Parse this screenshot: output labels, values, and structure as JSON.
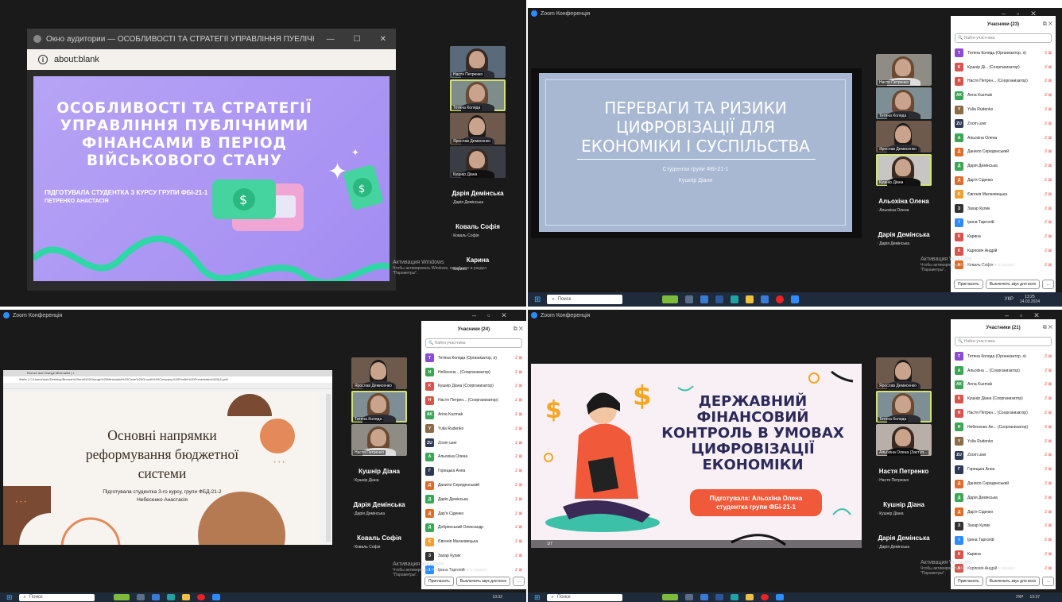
{
  "q1": {
    "browser_title": "Окно аудитории — ОСОБЛИВОСТІ ТА СТРАТЕГІЇ УПРАВЛІННЯ ПУЕЛІЧНИ...",
    "address": "about:blank",
    "slide_title_lines": [
      "ОСОБЛИВОСТІ ТА СТРАТЕГІЇ",
      "УПРАВЛІННЯ ПУБЛІЧНИМИ",
      "ФІНАНСАМИ В ПЕРІОД",
      "ВІЙСЬКОВОГО СТАНУ"
    ],
    "slide_sub1": "ПІДГОТУВАЛА СТУДЕНТКА 3 КУРСУ ГРУПИ ФБІ-21-1",
    "slide_sub2": "ПЕТРЕНКО АНАСТАСІЯ",
    "thumbs": [
      "Настя Петренко",
      "Тетяна Коляда",
      "Ярослав Демисенко",
      "Кушнір Діана"
    ],
    "name_tiles": [
      {
        "name": "Дарія Демінська",
        "sub": "Дарія Демінська"
      },
      {
        "name": "Коваль Софія",
        "sub": "Коваль Софія"
      },
      {
        "name": "Карина",
        "sub": "Карина"
      }
    ]
  },
  "q2": {
    "window_title": "Zoom Конференція",
    "slide_title_lines": [
      "ПЕРЕВАГИ ТА РИЗИКИ",
      "ЦИФРОВІЗАЦІЇ ДЛЯ",
      "ЕКОНОМІКИ І СУСПІЛЬСТВА"
    ],
    "slide_sub1": "Студентки групи ФБі-21-1",
    "slide_sub2": "Кушнір Діани",
    "thumbs": [
      "Настя Петренко",
      "Тетяна Коляда",
      "Ярослав Демисенко",
      "Кушнір Діана"
    ],
    "name_tiles": [
      {
        "name": "Альохіна Олена",
        "sub": "Альохіна Олена"
      },
      {
        "name": "Дарія Демінська",
        "sub": "Дарія Демінська"
      }
    ],
    "panel_title": "Учасники (23)",
    "search_placeholder": "Найти участника",
    "participants": [
      {
        "i": "T",
        "c": "#8a4bd6",
        "n": "Тетяна Коляда (Организатор, я)"
      },
      {
        "i": "К",
        "c": "#d9534f",
        "n": "Кушнір Ді... (Соорганизатор)"
      },
      {
        "i": "Н",
        "c": "#d9534f",
        "n": "Настя Петрен... (Соорганизатор)"
      },
      {
        "i": "AK",
        "c": "#3aa757",
        "n": "Anna Kuzmak"
      },
      {
        "i": "Y",
        "c": "#8b6b4a",
        "n": "Yulia Rudenko"
      },
      {
        "i": "ZU",
        "c": "#2e3a55",
        "n": "Zoom user"
      },
      {
        "i": "А",
        "c": "#3aa757",
        "n": "Альохіна Олена"
      },
      {
        "i": "Д",
        "c": "#e06c2a",
        "n": "Данило Середенський"
      },
      {
        "i": "Д",
        "c": "#3aa757",
        "n": "Дарія Демінська"
      },
      {
        "i": "Д",
        "c": "#e06c2a",
        "n": "Дар'я Сіденко"
      },
      {
        "i": "Є",
        "c": "#f0a030",
        "n": "Євгенія Малновецька"
      },
      {
        "i": "З",
        "c": "#333333",
        "n": "Захар Кулик"
      },
      {
        "i": "І",
        "c": "#2d8cff",
        "n": "Ірина Тарголій"
      },
      {
        "i": "К",
        "c": "#d9534f",
        "n": "Карина"
      },
      {
        "i": "К",
        "c": "#d9534f",
        "n": "Карповіч Андрій"
      },
      {
        "i": "К",
        "c": "#e06c2a",
        "n": "Коваль Софія"
      }
    ],
    "invite": "Пригласить",
    "mute_all": "Выключить звук для всех",
    "task_search": "Поиск",
    "time": "13:25",
    "date": "14.03.2024",
    "lang": "УКР"
  },
  "q3": {
    "window_title": "Zoom Конференція",
    "slide_title_lines": [
      "Основні напрямки",
      "реформування бюджетної",
      "системи"
    ],
    "slide_sub1": "Підготувала студентка 3-го курсу, групи ФБД-21-2",
    "slide_sub2": "Небесенко Анастасія",
    "tab_title": "Bronze and Orange Minimalist | ×",
    "url": "Файл | C:/Users/user/Desktop/Bronze%20and%20Orange%20Minimalist%20Circle%20Growth%20Company%20Profile%20Presentation%20(1).pdf",
    "thumbs": [
      "Ярослав Демисенко",
      "Тетяна Коляда",
      "Настя Петренко"
    ],
    "name_tiles": [
      {
        "name": "Кушнір Діана",
        "sub": "Кушнір Діана"
      },
      {
        "name": "Дарія Демінська",
        "sub": "Дарія Демінська"
      },
      {
        "name": "Коваль Софія",
        "sub": "Коваль Софія"
      }
    ],
    "panel_title": "Учасники (24)",
    "search_placeholder": "Найти участника",
    "participants": [
      {
        "i": "T",
        "c": "#8a4bd6",
        "n": "Тетяна Коляда (Организатор, я)"
      },
      {
        "i": "Н",
        "c": "#3aa757",
        "n": "Небесенк... (Соорганизатор)"
      },
      {
        "i": "К",
        "c": "#d9534f",
        "n": "Кушнір Діана (Соорганизатор)"
      },
      {
        "i": "Н",
        "c": "#d9534f",
        "n": "Настя Петрен... (Соорганизатор)"
      },
      {
        "i": "AK",
        "c": "#3aa757",
        "n": "Anna Kuzmak"
      },
      {
        "i": "Y",
        "c": "#8b6b4a",
        "n": "Yulia Rudenko"
      },
      {
        "i": "ZU",
        "c": "#2e3a55",
        "n": "Zoom user"
      },
      {
        "i": "А",
        "c": "#3aa757",
        "n": "Альохіна Олена"
      },
      {
        "i": "Г",
        "c": "#2e3a55",
        "n": "Горецька Анна"
      },
      {
        "i": "Д",
        "c": "#e06c2a",
        "n": "Данило Середенський"
      },
      {
        "i": "Д",
        "c": "#3aa757",
        "n": "Дарія Демінська"
      },
      {
        "i": "Д",
        "c": "#e06c2a",
        "n": "Дар'я Сіденко"
      },
      {
        "i": "Д",
        "c": "#3aa757",
        "n": "Добрянський Олександр"
      },
      {
        "i": "Є",
        "c": "#f0a030",
        "n": "Євгенія Малновецька"
      },
      {
        "i": "З",
        "c": "#333333",
        "n": "Захар Кулик"
      },
      {
        "i": "І",
        "c": "#2d8cff",
        "n": "Ірина Тарголій"
      }
    ],
    "invite": "Пригласить",
    "mute_all": "Выключить звук для всех",
    "task_search": "Поиск",
    "time": "13:32"
  },
  "q4": {
    "window_title": "Zoom Конференція",
    "slide_title_lines": [
      "ДЕРЖАВНИЙ",
      "ФІНАНСОВИЙ",
      "КОНТРОЛЬ В УМОВАХ",
      "ЦИФРОВІЗАЦІЇ",
      "ЕКОНОМІКИ"
    ],
    "badge_line1": "Підготувала: Альохіна Олена",
    "badge_line2": "студентка  групи ФБі-21-1",
    "page": "1/7",
    "thumbs": [
      "Ярослав Демисенко",
      "Тетяна Коляда",
      "Альохіна Олена (Заступ..."
    ],
    "name_tiles": [
      {
        "name": "Настя Петренко",
        "sub": "Настя Петренко"
      },
      {
        "name": "Кушнір Діана",
        "sub": "Кушнір Діана"
      },
      {
        "name": "Дарія Демінська",
        "sub": "Дарія Демінська"
      }
    ],
    "panel_title": "Участники (21)",
    "search_placeholder": "Найти участника",
    "participants": [
      {
        "i": "T",
        "c": "#8a4bd6",
        "n": "Тетяна Коляда (Организатор, я)"
      },
      {
        "i": "А",
        "c": "#3aa757",
        "n": "Альохіна ... (Соорганизатор)"
      },
      {
        "i": "AK",
        "c": "#3aa757",
        "n": "Anna Kuzmak"
      },
      {
        "i": "К",
        "c": "#d9534f",
        "n": "Кушнір Діана (Соорганизатор)"
      },
      {
        "i": "Н",
        "c": "#d9534f",
        "n": "Настя Петрен... (Соорганизатор)"
      },
      {
        "i": "Н",
        "c": "#3aa757",
        "n": "Небесенко Ан... (Соорганизатор)"
      },
      {
        "i": "Y",
        "c": "#8b6b4a",
        "n": "Yulia Rudenko"
      },
      {
        "i": "ZU",
        "c": "#2e3a55",
        "n": "Zoom user"
      },
      {
        "i": "Г",
        "c": "#2e3a55",
        "n": "Горецька Анна"
      },
      {
        "i": "Д",
        "c": "#e06c2a",
        "n": "Данило Середенський"
      },
      {
        "i": "Д",
        "c": "#3aa757",
        "n": "Дарія Демінська"
      },
      {
        "i": "Д",
        "c": "#e06c2a",
        "n": "Дар'я Сіденко"
      },
      {
        "i": "З",
        "c": "#333333",
        "n": "Захар Кулик"
      },
      {
        "i": "І",
        "c": "#2d8cff",
        "n": "Ірина Тарголій"
      },
      {
        "i": "К",
        "c": "#d9534f",
        "n": "Карина"
      },
      {
        "i": "К",
        "c": "#d9534f",
        "n": "Карповіч Андрій"
      }
    ],
    "invite": "Пригласить",
    "mute_all": "Выключить звук для всех",
    "task_search": "Поиск",
    "time": "13:37",
    "lang": "УКР"
  },
  "watermark": {
    "line1": "Активация Windows",
    "line2": "Чтобы активировать Windows, перейдите в раздел",
    "line3": "\"Параметры\"."
  },
  "colors": {
    "zoom_blue": "#2d8cff",
    "active_speaker": "#d3e07a",
    "muted_red": "#e44444"
  }
}
